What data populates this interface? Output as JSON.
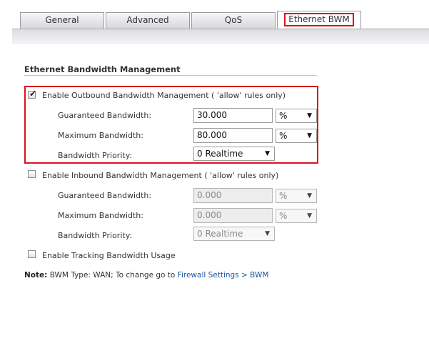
{
  "tabs": [
    {
      "label": "General"
    },
    {
      "label": "Advanced"
    },
    {
      "label": "QoS"
    },
    {
      "label": "Ethernet BWM",
      "active": true
    }
  ],
  "section": {
    "title": "Ethernet Bandwidth Management"
  },
  "outbound": {
    "enabled": true,
    "label": "Enable Outbound Bandwidth Management ( 'allow' rules only)",
    "guaranteed_label": "Guaranteed Bandwidth:",
    "guaranteed_value": "30.000",
    "guaranteed_unit": "%",
    "maximum_label": "Maximum Bandwidth:",
    "maximum_value": "80.000",
    "maximum_unit": "%",
    "priority_label": "Bandwidth Priority:",
    "priority_value": "0 Realtime"
  },
  "inbound": {
    "enabled": false,
    "label": "Enable Inbound Bandwidth Management ( 'allow' rules only)",
    "guaranteed_label": "Guaranteed Bandwidth:",
    "guaranteed_value": "0.000",
    "guaranteed_unit": "%",
    "maximum_label": "Maximum Bandwidth:",
    "maximum_value": "0.000",
    "maximum_unit": "%",
    "priority_label": "Bandwidth Priority:",
    "priority_value": "0 Realtime"
  },
  "tracking": {
    "enabled": false,
    "label": "Enable Tracking Bandwidth Usage"
  },
  "note": {
    "prefix": "Note:",
    "text": "BWM Type: WAN; To change go to ",
    "link": "Firewall Settings > BWM"
  },
  "colors": {
    "highlight": "#d7141c",
    "link": "#1a57a5"
  },
  "icons": {
    "check": "check-icon",
    "dropdown": "chevron-down-icon"
  }
}
